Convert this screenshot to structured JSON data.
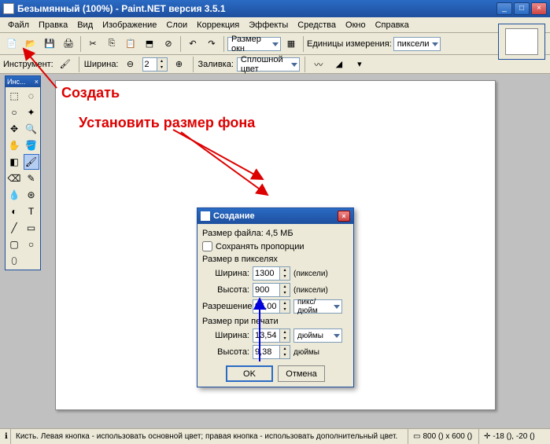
{
  "titlebar": {
    "title": "Безымянный (100%) - Paint.NET версия 3.5.1"
  },
  "menu": [
    "Файл",
    "Правка",
    "Вид",
    "Изображение",
    "Слои",
    "Коррекция",
    "Эффекты",
    "Средства",
    "Окно",
    "Справка"
  ],
  "toolbar1": {
    "zoom_label": "Размер окн",
    "units_label": "Единицы измерения:",
    "units_value": "пиксели"
  },
  "toolbar2": {
    "tool_label": "Инструмент:",
    "width_label": "Ширина:",
    "width_value": "2",
    "fill_label": "Заливка:",
    "fill_value": "Сплошной цвет"
  },
  "toolpanel": {
    "title": "Инс..."
  },
  "dialog": {
    "title": "Создание",
    "filesize_label": "Размер файла: 4,5 МБ",
    "keep_ratio": "Сохранять пропорции",
    "group_px": "Размер в пикселях",
    "width_label": "Ширина:",
    "width_value": "1300",
    "px_unit": "(пиксели)",
    "height_label": "Высота:",
    "height_value": "900",
    "res_label": "Разрешение:",
    "res_value": "96,00",
    "res_unit": "пикс/дюйм",
    "group_print": "Размер при печати",
    "pwidth_label": "Ширина:",
    "pwidth_value": "13,54",
    "print_unit": "дюймы",
    "pheight_label": "Высота:",
    "pheight_value": "9,38",
    "print_unit2": "дюймы",
    "ok": "OK",
    "cancel": "Отмена"
  },
  "status": {
    "main": "Кисть. Левая кнопка - использовать основной цвет; правая кнопка - использовать дополнительный цвет.",
    "dims": "800 () x 600 ()",
    "pos": "-18 (), -20 ()"
  },
  "annotations": {
    "create": "Создать",
    "setbg": "Установить размер фона"
  }
}
